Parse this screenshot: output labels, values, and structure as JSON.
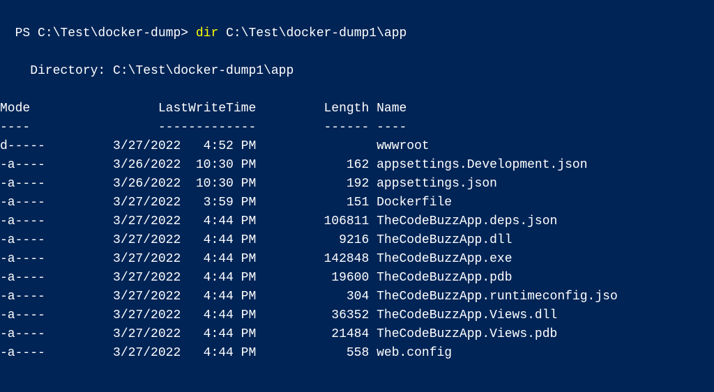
{
  "prompt": {
    "prefix": "PS C:\\Test\\docker-dump> ",
    "command": "dir",
    "argument": " C:\\Test\\docker-dump1\\app"
  },
  "directory_line": "    Directory: C:\\Test\\docker-dump1\\app",
  "header": {
    "mode": "Mode",
    "lastwrite": "LastWriteTime",
    "length": "Length",
    "name": "Name"
  },
  "header_line": "Mode                 LastWriteTime         Length Name",
  "separator_line": "----                 -------------         ------ ----",
  "rows": [
    {
      "mode": "d-----",
      "date": "3/27/2022",
      "time": "4:52 PM",
      "length": "",
      "name": "wwwroot"
    },
    {
      "mode": "-a----",
      "date": "3/26/2022",
      "time": "10:30 PM",
      "length": "162",
      "name": "appsettings.Development.json"
    },
    {
      "mode": "-a----",
      "date": "3/26/2022",
      "time": "10:30 PM",
      "length": "192",
      "name": "appsettings.json"
    },
    {
      "mode": "-a----",
      "date": "3/27/2022",
      "time": "3:59 PM",
      "length": "151",
      "name": "Dockerfile"
    },
    {
      "mode": "-a----",
      "date": "3/27/2022",
      "time": "4:44 PM",
      "length": "106811",
      "name": "TheCodeBuzzApp.deps.json"
    },
    {
      "mode": "-a----",
      "date": "3/27/2022",
      "time": "4:44 PM",
      "length": "9216",
      "name": "TheCodeBuzzApp.dll"
    },
    {
      "mode": "-a----",
      "date": "3/27/2022",
      "time": "4:44 PM",
      "length": "142848",
      "name": "TheCodeBuzzApp.exe"
    },
    {
      "mode": "-a----",
      "date": "3/27/2022",
      "time": "4:44 PM",
      "length": "19600",
      "name": "TheCodeBuzzApp.pdb"
    },
    {
      "mode": "-a----",
      "date": "3/27/2022",
      "time": "4:44 PM",
      "length": "304",
      "name": "TheCodeBuzzApp.runtimeconfig.jso"
    },
    {
      "mode": "-a----",
      "date": "3/27/2022",
      "time": "4:44 PM",
      "length": "36352",
      "name": "TheCodeBuzzApp.Views.dll"
    },
    {
      "mode": "-a----",
      "date": "3/27/2022",
      "time": "4:44 PM",
      "length": "21484",
      "name": "TheCodeBuzzApp.Views.pdb"
    },
    {
      "mode": "-a----",
      "date": "3/27/2022",
      "time": "4:44 PM",
      "length": "558",
      "name": "web.config"
    }
  ]
}
